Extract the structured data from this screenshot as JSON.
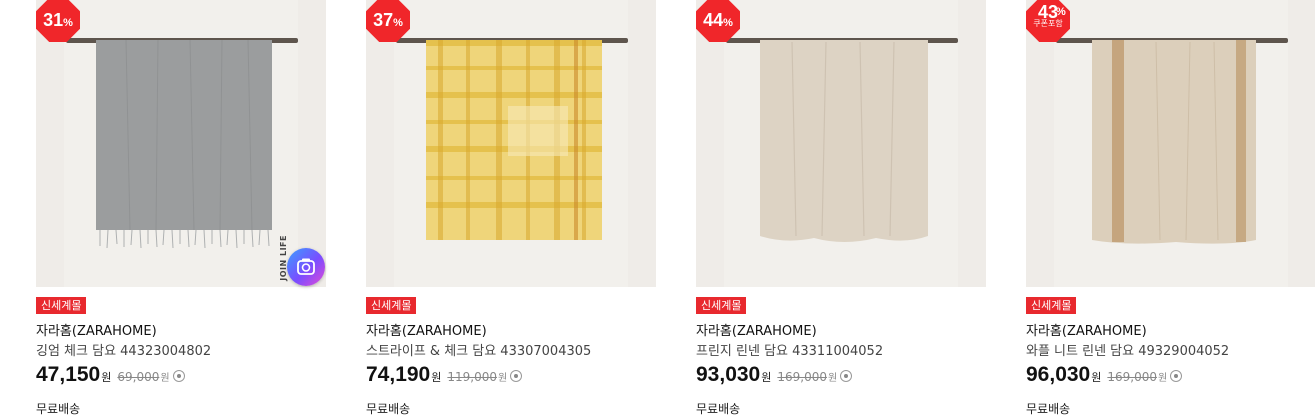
{
  "products": [
    {
      "discount": "31",
      "discount_unit": "%",
      "coupon": "",
      "tag": "신세계몰",
      "brand": "자라홈(ZARAHOME)",
      "name": "깅엄 체크 담요 44323004802",
      "price": "47,150",
      "price_unit": "원",
      "original_price": "69,000",
      "original_unit": "원",
      "shipping": "무료배송",
      "overlay_text": "JOIN LIFE",
      "blanket_color": "#9b9d9e"
    },
    {
      "discount": "37",
      "discount_unit": "%",
      "coupon": "",
      "tag": "신세계몰",
      "brand": "자라홈(ZARAHOME)",
      "name": "스트라이프 & 체크 담요 43307004305",
      "price": "74,190",
      "price_unit": "원",
      "original_price": "119,000",
      "original_unit": "원",
      "shipping": "무료배송",
      "blanket_color": "#e9c95a"
    },
    {
      "discount": "44",
      "discount_unit": "%",
      "coupon": "",
      "tag": "신세계몰",
      "brand": "자라홈(ZARAHOME)",
      "name": "프린지 린넨 담요 43311004052",
      "price": "93,030",
      "price_unit": "원",
      "original_price": "169,000",
      "original_unit": "원",
      "shipping": "무료배송",
      "blanket_color": "#ddd3c4"
    },
    {
      "discount": "43",
      "discount_unit": "%",
      "coupon": "쿠폰포함",
      "tag": "신세계몰",
      "brand": "자라홈(ZARAHOME)",
      "name": "와플 니트 린넨 담요 49329004052",
      "price": "96,030",
      "price_unit": "원",
      "original_price": "169,000",
      "original_unit": "원",
      "shipping": "무료배송",
      "blanket_color": "#d9cbb5"
    }
  ],
  "colors": {
    "discount_badge": "#f0262a",
    "tag": "#e8292e"
  },
  "icons": {
    "image_search": "camera-icon",
    "price_info": "info-icon"
  }
}
